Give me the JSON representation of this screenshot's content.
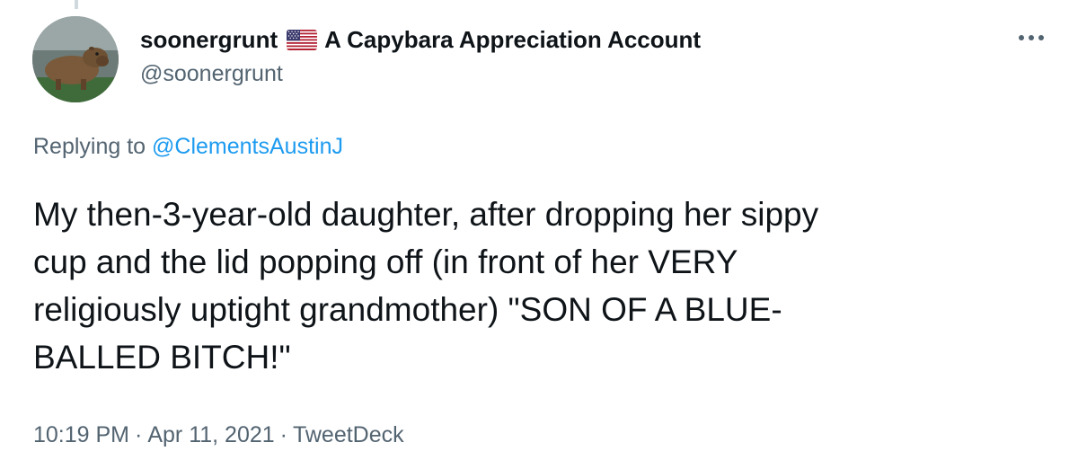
{
  "author": {
    "display_name": "soonergrunt",
    "flag_icon": "us-flag-icon",
    "name_suffix": "A Capybara Appreciation Account",
    "handle": "@soonergrunt",
    "avatar_icon": "capybara-avatar"
  },
  "reply": {
    "prefix": "Replying to",
    "mention": "@ClementsAustinJ"
  },
  "tweet": {
    "lines": [
      "My then-3-year-old daughter, after dropping her sippy",
      "cup and the lid popping off (in front of her VERY",
      "religiously uptight grandmother) \"SON OF A BLUE-",
      "BALLED BITCH!\""
    ]
  },
  "meta": {
    "time": "10:19 PM",
    "separator": "·",
    "date": "Apr 11, 2021",
    "source": "TweetDeck"
  },
  "colors": {
    "text": "#0f1419",
    "secondary": "#536471",
    "link": "#1d9bf0"
  }
}
